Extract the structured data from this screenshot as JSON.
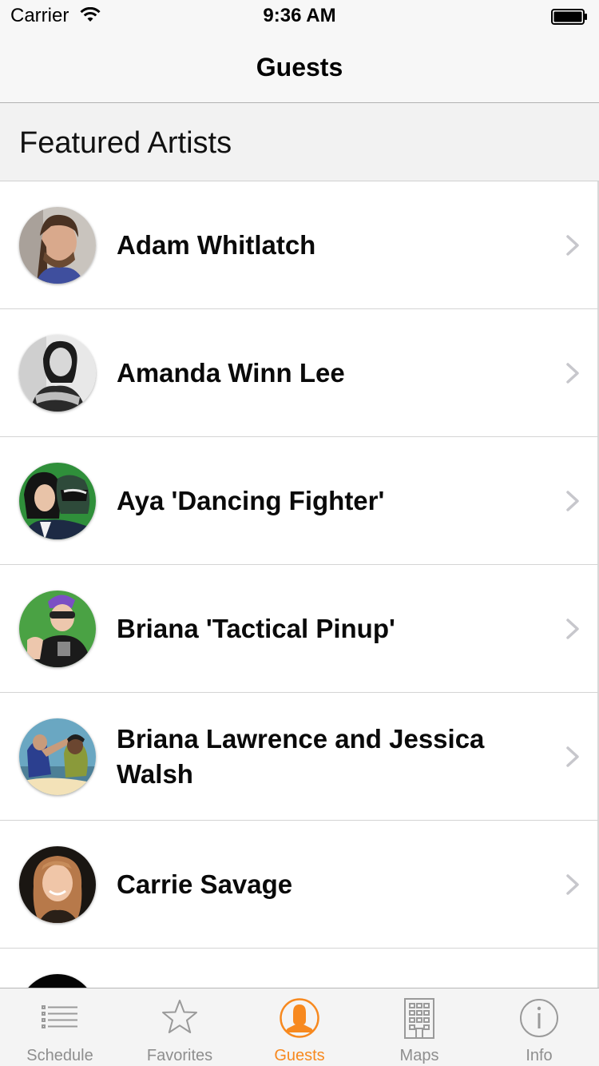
{
  "status_bar": {
    "carrier": "Carrier",
    "time": "9:36 AM",
    "wifi_icon": "wifi-icon",
    "battery_icon": "battery-icon"
  },
  "nav": {
    "title": "Guests"
  },
  "section": {
    "title": "Featured Artists"
  },
  "guests": [
    {
      "name": "Adam Whitlatch",
      "avatar": "avatar-photo"
    },
    {
      "name": "Amanda Winn Lee",
      "avatar": "avatar-photo"
    },
    {
      "name": "Aya 'Dancing Fighter'",
      "avatar": "avatar-photo"
    },
    {
      "name": "Briana 'Tactical Pinup'",
      "avatar": "avatar-photo"
    },
    {
      "name": "Briana Lawrence and Jessica Walsh",
      "avatar": "avatar-photo"
    },
    {
      "name": "Carrie Savage",
      "avatar": "avatar-photo"
    }
  ],
  "tab_bar": {
    "tabs": [
      {
        "label": "Schedule",
        "icon": "list-icon",
        "active": false
      },
      {
        "label": "Favorites",
        "icon": "star-icon",
        "active": false
      },
      {
        "label": "Guests",
        "icon": "person-icon",
        "active": true
      },
      {
        "label": "Maps",
        "icon": "building-icon",
        "active": false
      },
      {
        "label": "Info",
        "icon": "info-icon",
        "active": false
      }
    ]
  },
  "colors": {
    "accent": "#f7891f",
    "inactive": "#8e8e8e"
  }
}
